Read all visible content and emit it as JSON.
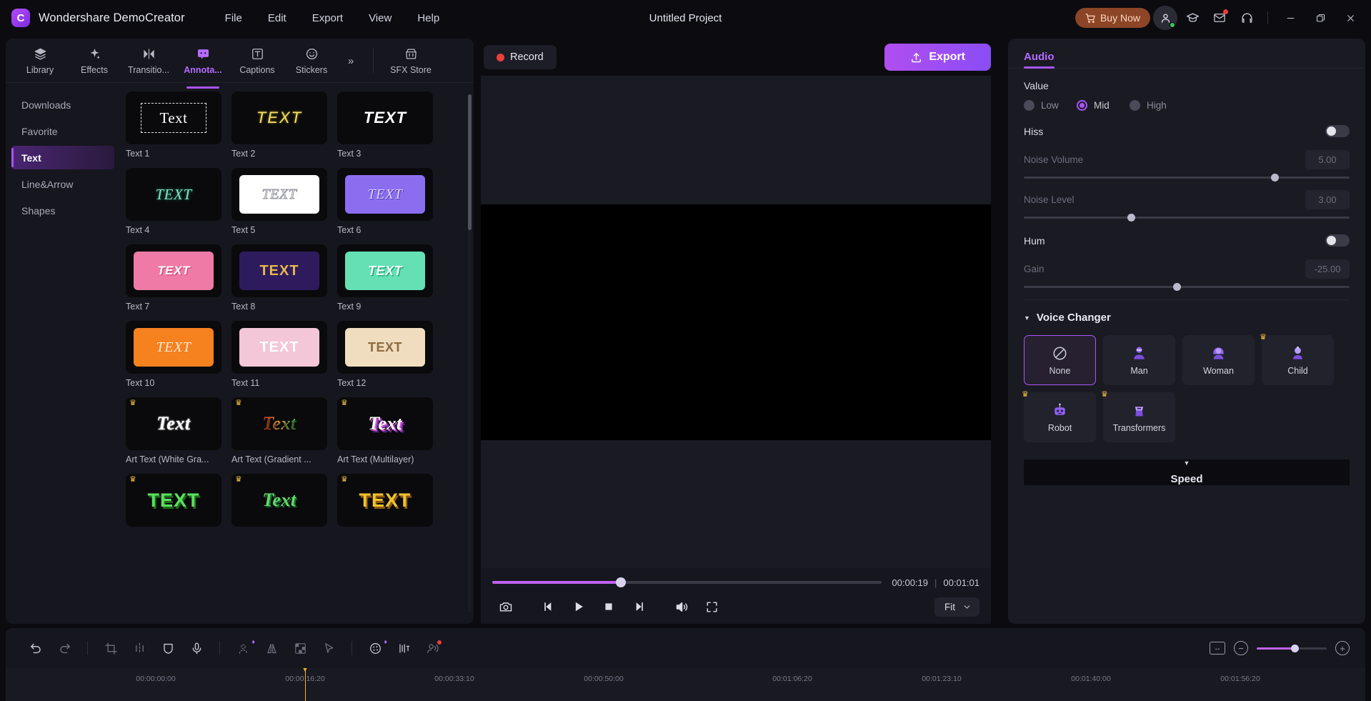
{
  "titlebar": {
    "app_name": "Wondershare DemoCreator",
    "logo_glyph": "C",
    "menus": [
      "File",
      "Edit",
      "Export",
      "View",
      "Help"
    ],
    "project_title": "Untitled Project",
    "buy_now": "Buy Now",
    "icons": [
      "cart-icon",
      "user-avatar-icon",
      "graduation-cap-icon",
      "mail-icon",
      "headset-icon",
      "minimize-icon",
      "maximize-icon",
      "close-icon"
    ]
  },
  "browser": {
    "categories": [
      {
        "label": "Library",
        "icon": "layers-icon",
        "active": false
      },
      {
        "label": "Effects",
        "icon": "sparkle-icon",
        "active": false
      },
      {
        "label": "Transitio...",
        "icon": "transition-icon",
        "active": false
      },
      {
        "label": "Annota...",
        "icon": "annotation-icon",
        "active": true
      },
      {
        "label": "Captions",
        "icon": "captions-icon",
        "active": false
      },
      {
        "label": "Stickers",
        "icon": "smiley-icon",
        "active": false
      }
    ],
    "more_label": "»",
    "store": {
      "label": "SFX Store",
      "icon": "store-icon"
    },
    "subnav": [
      {
        "label": "Downloads",
        "active": false
      },
      {
        "label": "Favorite",
        "active": false
      },
      {
        "label": "Text",
        "active": true
      },
      {
        "label": "Line&Arrow",
        "active": false
      },
      {
        "label": "Shapes",
        "active": false
      }
    ],
    "tiles": [
      {
        "label": "Text 1",
        "preview": "Text",
        "style": "dashed-serif",
        "premium": false
      },
      {
        "label": "Text 2",
        "preview": "TEXT",
        "style": "yellow-outline",
        "premium": false
      },
      {
        "label": "Text 3",
        "preview": "TEXT",
        "style": "white-bold-italic",
        "premium": false
      },
      {
        "label": "Text 4",
        "preview": "TEXT",
        "style": "mint-script",
        "premium": false
      },
      {
        "label": "Text 5",
        "preview": "TEXT",
        "style": "white-card-outline",
        "premium": false
      },
      {
        "label": "Text 6",
        "preview": "TEXT",
        "style": "purple-card",
        "premium": false
      },
      {
        "label": "Text 7",
        "preview": "TEXT",
        "style": "pink-card",
        "premium": false
      },
      {
        "label": "Text 8",
        "preview": "TEXT",
        "style": "indigo-gold",
        "premium": false
      },
      {
        "label": "Text 9",
        "preview": "TEXT",
        "style": "mint-card",
        "premium": false
      },
      {
        "label": "Text 10",
        "preview": "TEXT",
        "style": "orange-card",
        "premium": false
      },
      {
        "label": "Text 11",
        "preview": "TEXT",
        "style": "lightpink-card",
        "premium": false
      },
      {
        "label": "Text 12",
        "preview": "TEXT",
        "style": "cream-card",
        "premium": false
      },
      {
        "label": "Art Text (White Gra...",
        "preview": "Text",
        "style": "art-white",
        "premium": true
      },
      {
        "label": "Art Text (Gradient ...",
        "preview": "Text",
        "style": "art-gradient",
        "premium": true
      },
      {
        "label": "Art Text (Multilayer)",
        "preview": "Text",
        "style": "art-multilayer",
        "premium": true
      },
      {
        "label": "",
        "preview": "TEXT",
        "style": "art-green",
        "premium": true
      },
      {
        "label": "",
        "preview": "Text",
        "style": "art-green2",
        "premium": true
      },
      {
        "label": "",
        "preview": "TEXT",
        "style": "art-yellow",
        "premium": true
      }
    ]
  },
  "player": {
    "record_label": "Record",
    "export_label": "Export",
    "current_time": "00:00:19",
    "total_time": "00:01:01",
    "time_separator": "|",
    "progress_percent": 33,
    "fit_label": "Fit",
    "controls": [
      "snapshot-icon",
      "prev-frame-icon",
      "play-icon",
      "stop-icon",
      "next-frame-icon",
      "volume-icon",
      "fullscreen-icon"
    ]
  },
  "properties": {
    "tab": "Audio",
    "value_label": "Value",
    "value_options": [
      {
        "label": "Low",
        "selected": false
      },
      {
        "label": "Mid",
        "selected": true
      },
      {
        "label": "High",
        "selected": false
      }
    ],
    "hiss": {
      "label": "Hiss",
      "enabled": false
    },
    "noise_volume": {
      "label": "Noise Volume",
      "value": "5.00",
      "percent": 77
    },
    "noise_level": {
      "label": "Noise Level",
      "value": "3.00",
      "percent": 33
    },
    "hum": {
      "label": "Hum",
      "enabled": false
    },
    "gain": {
      "label": "Gain",
      "value": "-25.00",
      "percent": 47
    },
    "voice_changer": {
      "title": "Voice Changer",
      "items": [
        {
          "label": "None",
          "icon": "no-entry-icon",
          "selected": true,
          "premium": false
        },
        {
          "label": "Man",
          "icon": "man-avatar-icon",
          "selected": false,
          "premium": false
        },
        {
          "label": "Woman",
          "icon": "woman-avatar-icon",
          "selected": false,
          "premium": false
        },
        {
          "label": "Child",
          "icon": "child-avatar-icon",
          "selected": false,
          "premium": true
        },
        {
          "label": "Robot",
          "icon": "robot-avatar-icon",
          "selected": false,
          "premium": true
        },
        {
          "label": "Transformers",
          "icon": "transformers-avatar-icon",
          "selected": false,
          "premium": true
        }
      ]
    },
    "speed": {
      "title": "Speed"
    }
  },
  "toolbar": {
    "buttons": [
      {
        "name": "undo-icon",
        "badge": "none"
      },
      {
        "name": "redo-icon",
        "badge": "none"
      },
      {
        "name": "crop-icon",
        "badge": "none"
      },
      {
        "name": "split-icon",
        "badge": "none"
      },
      {
        "name": "mask-icon",
        "badge": "none"
      },
      {
        "name": "microphone-icon",
        "badge": "none"
      },
      {
        "name": "ai-avatar-icon",
        "badge": "gem"
      },
      {
        "name": "mirror-icon",
        "badge": "none"
      },
      {
        "name": "mosaic-icon",
        "badge": "none"
      },
      {
        "name": "pointer-icon",
        "badge": "none"
      },
      {
        "name": "color-wheel-icon",
        "badge": "gem"
      },
      {
        "name": "text-adjust-icon",
        "badge": "none"
      },
      {
        "name": "denoise-icon",
        "badge": "dot"
      }
    ],
    "fit_timeline_icon": "fit-timeline-icon",
    "zoom_out_icon": "zoom-out-icon",
    "zoom_in_icon": "zoom-in-icon",
    "zoom_percent": 55
  },
  "timeline": {
    "ticks": [
      "00:00:00:00",
      "00:00:16:20",
      "00:00:33:10",
      "00:00:50:00",
      "00:01:06:20",
      "00:01:23:10",
      "00:01:40:00",
      "00:01:56:20"
    ],
    "playhead_tick_index": 1
  }
}
